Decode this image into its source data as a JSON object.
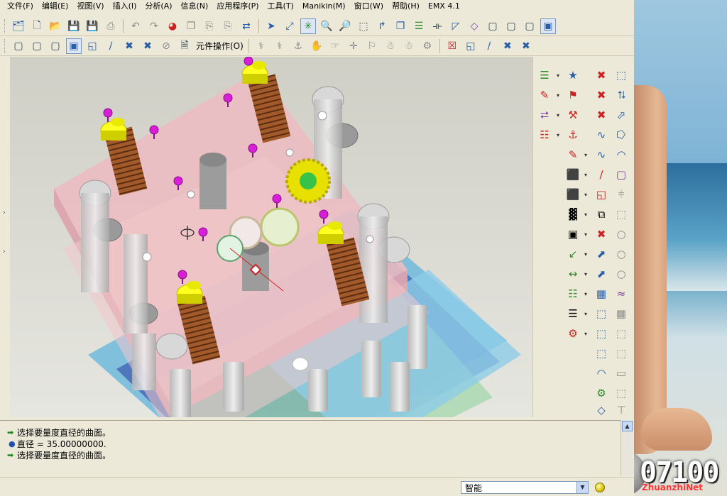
{
  "menubar": {
    "items": [
      "文件(F)",
      "编辑(E)",
      "视图(V)",
      "插入(I)",
      "分析(A)",
      "信息(N)",
      "应用程序(P)",
      "工具(T)",
      "Manikin(M)",
      "窗口(W)",
      "帮助(H)",
      "EMX 4.1"
    ]
  },
  "toolbar2": {
    "component_ops_label": "元件操作(O)"
  },
  "messages": [
    {
      "marker": "arrow",
      "text": "选择要量度直径的曲面。"
    },
    {
      "marker": "dot",
      "text": "直径 = 35.00000000."
    },
    {
      "marker": "arrow",
      "text": "选择要量度直径的曲面。"
    }
  ],
  "statusbar": {
    "filter_value": "智能"
  },
  "watermark": {
    "counter": "07100",
    "site": "ZhuanzhiNet"
  },
  "colors": {
    "plate_pink": "#e8b9bf",
    "plate_blue": "#7fc3df",
    "guide_yellow": "#ffff22",
    "spring_brown": "#a0522d",
    "pin_magenta": "#d61fd6",
    "gear_yellow": "#e8e000"
  }
}
